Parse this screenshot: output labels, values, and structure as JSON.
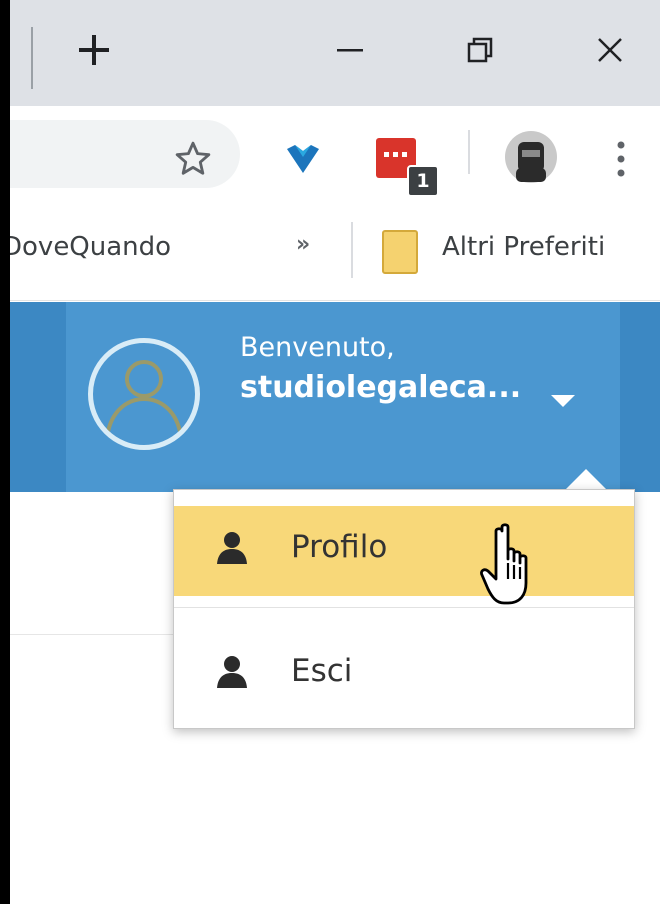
{
  "browser": {
    "titlebar": {
      "new_tab_icon": "plus-icon",
      "minimize_icon": "minimize-icon",
      "restore_icon": "restore-icon",
      "close_icon": "close-icon"
    },
    "toolbar": {
      "star_icon": "star-icon",
      "extension_1_icon": "heart-diamond-icon",
      "extension_2_icon": "red-extension-icon",
      "extension_2_badge": "1",
      "profile_icon": "profile-avatar-icon",
      "menu_icon": "vertical-dots-icon"
    },
    "bookmarks": {
      "visible_item": "DoveQuando",
      "overflow_label": "»",
      "other_folder_label": "Altri Preferiti"
    }
  },
  "site": {
    "header_color": "#3c88c3",
    "panel_color": "#4b97d0",
    "user": {
      "welcome": "Benvenuto,",
      "username": "studiolegaleca..."
    },
    "menu": {
      "items": [
        {
          "label": "Profilo",
          "icon": "user-icon",
          "highlighted": true
        },
        {
          "label": "Esci",
          "icon": "user-icon",
          "highlighted": false
        }
      ],
      "highlight_color": "#f8d879"
    }
  }
}
